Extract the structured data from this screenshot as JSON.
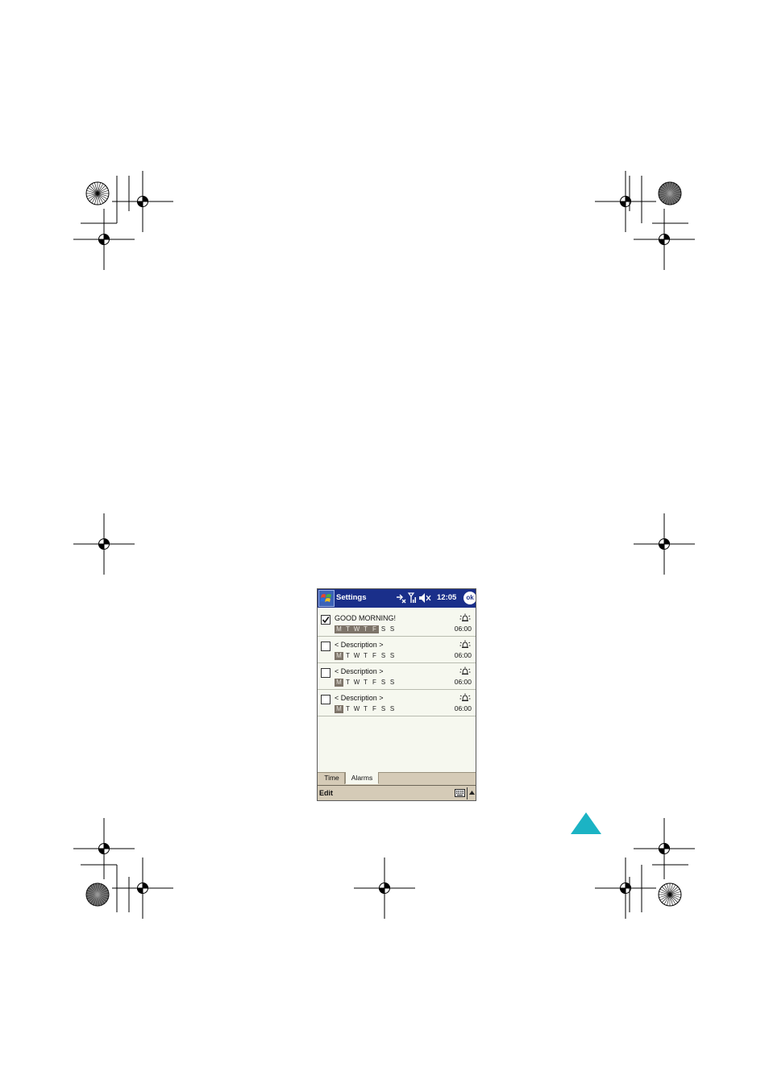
{
  "window": {
    "title": "Settings",
    "clock": "12:05",
    "ok_label": "ok"
  },
  "alarms": [
    {
      "checked": true,
      "description": "GOOD MORNING!",
      "days": [
        "M",
        "T",
        "W",
        "T",
        "F",
        "S",
        "S"
      ],
      "active_days": [
        0,
        1,
        2,
        3,
        4
      ],
      "time": "06:00"
    },
    {
      "checked": false,
      "description": "< Description >",
      "days": [
        "M",
        "T",
        "W",
        "T",
        "F",
        "S",
        "S"
      ],
      "active_days": [
        0
      ],
      "time": "06:00"
    },
    {
      "checked": false,
      "description": "< Description >",
      "days": [
        "M",
        "T",
        "W",
        "T",
        "F",
        "S",
        "S"
      ],
      "active_days": [
        0
      ],
      "time": "06:00"
    },
    {
      "checked": false,
      "description": "< Description >",
      "days": [
        "M",
        "T",
        "W",
        "T",
        "F",
        "S",
        "S"
      ],
      "active_days": [
        0
      ],
      "time": "06:00"
    }
  ],
  "tabs": [
    {
      "label": "Time",
      "active": false
    },
    {
      "label": "Alarms",
      "active": true
    }
  ],
  "menu": {
    "edit_label": "Edit"
  },
  "colors": {
    "title_bar": "#1a2f8a",
    "active_day": "#7d7469",
    "menu_bar": "#d5cbb7",
    "page_corner_triangle": "#1bb3c4"
  }
}
